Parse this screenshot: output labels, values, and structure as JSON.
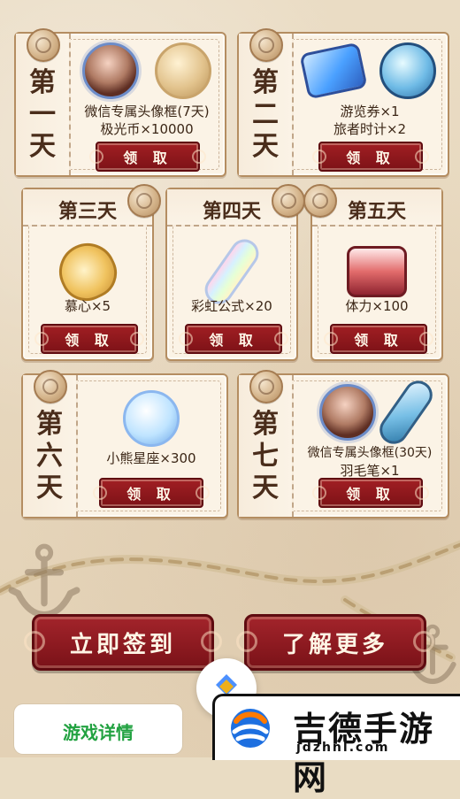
{
  "colors": {
    "accent_red": "#8a161c",
    "paper": "#fbf3e6",
    "text_dark": "#3b2616",
    "green": "#22a241"
  },
  "cards": [
    {
      "day_top": "第",
      "day_mid": "一",
      "day_bot": "天",
      "lines": [
        "微信专属头像框(7天)",
        "极光币×10000"
      ],
      "button": "领 取",
      "icons": [
        "avatar-frame-icon",
        "aurora-coin-icon"
      ]
    },
    {
      "day_top": "第",
      "day_mid": "二",
      "day_bot": "天",
      "lines": [
        "游览券×1",
        "旅者时计×2"
      ],
      "button": "领 取",
      "icons": [
        "ticket-icon",
        "pocket-watch-icon"
      ]
    },
    {
      "day": "第三天",
      "lines": [
        "慕心×5"
      ],
      "button": "领 取",
      "icons": [
        "lute-icon"
      ]
    },
    {
      "day": "第四天",
      "lines": [
        "彩虹公式×20"
      ],
      "button": "领 取",
      "icons": [
        "rainbow-tube-icon"
      ]
    },
    {
      "day": "第五天",
      "lines": [
        "体力×100"
      ],
      "button": "领 取",
      "icons": [
        "food-basket-icon"
      ]
    },
    {
      "day_top": "第",
      "day_mid": "六",
      "day_bot": "天",
      "lines": [
        "小熊星座×300"
      ],
      "button": "领 取",
      "icons": [
        "star-coin-icon"
      ]
    },
    {
      "day_top": "第",
      "day_mid": "七",
      "day_bot": "天",
      "lines": [
        "微信专属头像框(30天)",
        "羽毛笔×1"
      ],
      "button": "领 取",
      "icons": [
        "avatar-frame-icon",
        "quill-pen-icon"
      ]
    }
  ],
  "actions": {
    "sign_in": "立即签到",
    "learn_more": "了解更多"
  },
  "bottom": {
    "details": "游戏详情"
  },
  "watermark": {
    "title": "吉德手游网",
    "subtitle": "jdzhnl.com"
  }
}
